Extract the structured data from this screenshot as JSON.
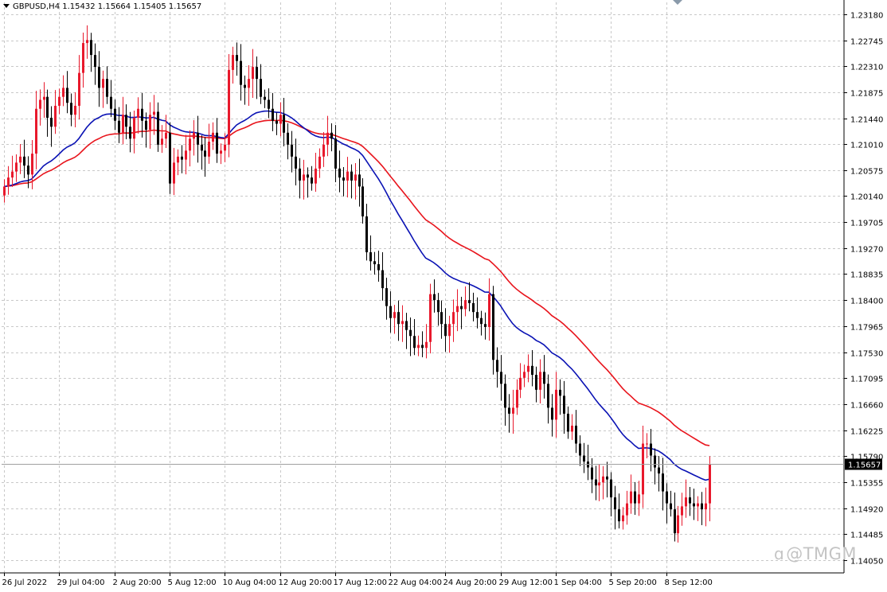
{
  "header": {
    "symbol": "GBPUSD,H4",
    "ohlc": "1.15432 1.15664 1.15405 1.15657"
  },
  "watermark": {
    "icon": "tmgm-logo-icon",
    "text": "@TMGM"
  },
  "colors": {
    "bull": "#e8192c",
    "bear": "#000000",
    "ma_fast": "#0a12b4",
    "ma_slow": "#e8141c",
    "grid": "#c8c8c8",
    "price_line": "#a0a0a0"
  },
  "chart_data": {
    "type": "candlestick",
    "symbol": "GBPUSD",
    "timeframe": "H4",
    "grid": true,
    "ylim": [
      1.14,
      1.233
    ],
    "y_ticks": [
      "1.23180",
      "1.22745",
      "1.22310",
      "1.21875",
      "1.21440",
      "1.21010",
      "1.20575",
      "1.20140",
      "1.19705",
      "1.19270",
      "1.18835",
      "1.18400",
      "1.17965",
      "1.17530",
      "1.17095",
      "1.16660",
      "1.16225",
      "1.15790",
      "1.15355",
      "1.14920",
      "1.14485",
      "1.14050"
    ],
    "x_tick_labels": [
      {
        "label": "26 Jul 2022",
        "bar": 0
      },
      {
        "label": "29 Jul 04:00",
        "bar": 14
      },
      {
        "label": "2 Aug 20:00",
        "bar": 28
      },
      {
        "label": "5 Aug 12:00",
        "bar": 42
      },
      {
        "label": "10 Aug 04:00",
        "bar": 56
      },
      {
        "label": "12 Aug 20:00",
        "bar": 70
      },
      {
        "label": "17 Aug 12:00",
        "bar": 84
      },
      {
        "label": "22 Aug 04:00",
        "bar": 98
      },
      {
        "label": "24 Aug 20:00",
        "bar": 112
      },
      {
        "label": "29 Aug 12:00",
        "bar": 126
      },
      {
        "label": "1 Sep 04:00",
        "bar": 140
      },
      {
        "label": "5 Sep 20:00",
        "bar": 154
      },
      {
        "label": "8 Sep 12:00",
        "bar": 168
      }
    ],
    "current_price": "1.15657",
    "close": [
      1.203,
      1.2045,
      1.2055,
      1.207,
      1.208,
      1.2065,
      1.205,
      1.2085,
      1.216,
      1.2175,
      1.218,
      1.2145,
      1.213,
      1.2165,
      1.218,
      1.2195,
      1.217,
      1.215,
      1.2165,
      1.222,
      1.227,
      1.2275,
      1.225,
      1.223,
      1.2195,
      1.221,
      1.218,
      1.216,
      1.214,
      1.212,
      1.215,
      1.213,
      1.211,
      1.2145,
      1.216,
      1.214,
      1.2125,
      1.215,
      1.2155,
      1.21,
      1.211,
      1.212,
      1.2035,
      1.207,
      1.208,
      1.2075,
      1.209,
      1.211,
      1.212,
      1.21,
      1.209,
      1.208,
      1.2105,
      1.212,
      1.2085,
      1.209,
      1.21,
      1.2225,
      1.225,
      1.224,
      1.22,
      1.2195,
      1.221,
      1.223,
      1.221,
      1.218,
      1.2175,
      1.216,
      1.214,
      1.2135,
      1.215,
      1.212,
      1.21,
      1.208,
      1.206,
      1.204,
      1.205,
      1.2045,
      1.2035,
      1.206,
      1.208,
      1.21,
      1.212,
      1.211,
      1.206,
      1.2045,
      1.204,
      1.2055,
      1.204,
      1.205,
      1.203,
      1.198,
      1.192,
      1.1905,
      1.19,
      1.189,
      1.186,
      1.183,
      1.181,
      1.182,
      1.18,
      1.1805,
      1.179,
      1.178,
      1.176,
      1.1765,
      1.176,
      1.177,
      1.185,
      1.184,
      1.182,
      1.18,
      1.178,
      1.18,
      1.182,
      1.183,
      1.1825,
      1.184,
      1.1835,
      1.182,
      1.181,
      1.18,
      1.1795,
      1.185,
      1.174,
      1.172,
      1.17,
      1.166,
      1.165,
      1.166,
      1.169,
      1.171,
      1.172,
      1.173,
      1.1715,
      1.169,
      1.172,
      1.17,
      1.166,
      1.164,
      1.169,
      1.168,
      1.165,
      1.162,
      1.163,
      1.16,
      1.158,
      1.157,
      1.156,
      1.154,
      1.153,
      1.1535,
      1.1545,
      1.154,
      1.151,
      1.149,
      1.147,
      1.148,
      1.15,
      1.152,
      1.15,
      1.1515,
      1.16,
      1.16,
      1.158,
      1.156,
      1.155,
      1.152,
      1.15,
      1.149,
      1.145,
      1.148,
      1.1495,
      1.151,
      1.15,
      1.1495,
      1.15,
      1.149,
      1.15,
      1.1565
    ],
    "ma_fast": {
      "period": 50,
      "color": "#0a12b4"
    },
    "ma_slow": {
      "period": 100,
      "color": "#e8141c"
    }
  }
}
